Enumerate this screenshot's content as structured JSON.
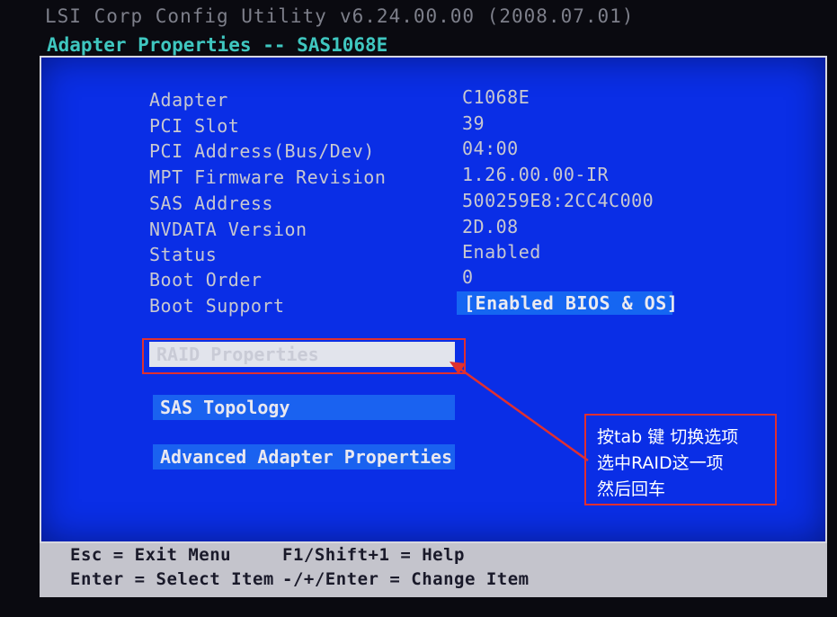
{
  "header": {
    "title": "LSI Corp Config Utility",
    "version": "v6.24.00.00 (2008.07.01)",
    "page_title": "Adapter Properties -- SAS1068E"
  },
  "properties": [
    {
      "label": "Adapter",
      "value": "C1068E"
    },
    {
      "label": "PCI Slot",
      "value": "39"
    },
    {
      "label": "PCI Address(Bus/Dev)",
      "value": "04:00"
    },
    {
      "label": "MPT Firmware Revision",
      "value": "1.26.00.00-IR"
    },
    {
      "label": "SAS Address",
      "value": "500259E8:2CC4C000"
    },
    {
      "label": "NVDATA Version",
      "value": "2D.08"
    },
    {
      "label": "Status",
      "value": "Enabled"
    },
    {
      "label": "Boot Order",
      "value": "0"
    },
    {
      "label": "Boot Support",
      "value": "[Enabled BIOS & OS]"
    }
  ],
  "menu": [
    {
      "label": "RAID Properties",
      "selected": true
    },
    {
      "label": "SAS Topology",
      "selected": false
    },
    {
      "label": "Advanced Adapter Properties",
      "selected": false
    }
  ],
  "footer": {
    "esc": "Esc = Exit Menu",
    "help": "F1/Shift+1 = Help",
    "enter": "Enter = Select Item",
    "change": "-/+/Enter = Change Item"
  },
  "annotation": {
    "line1": "按tab 键 切换选项",
    "line2": "选中RAID这一项",
    "line3": "然后回车"
  },
  "colors": {
    "panel_blue": "#0a2ee6",
    "field_blue": "#1566f2",
    "highlight": "#e2e4ec",
    "annotation_red": "#e03030",
    "heading_cyan": "#3fc7c0"
  }
}
